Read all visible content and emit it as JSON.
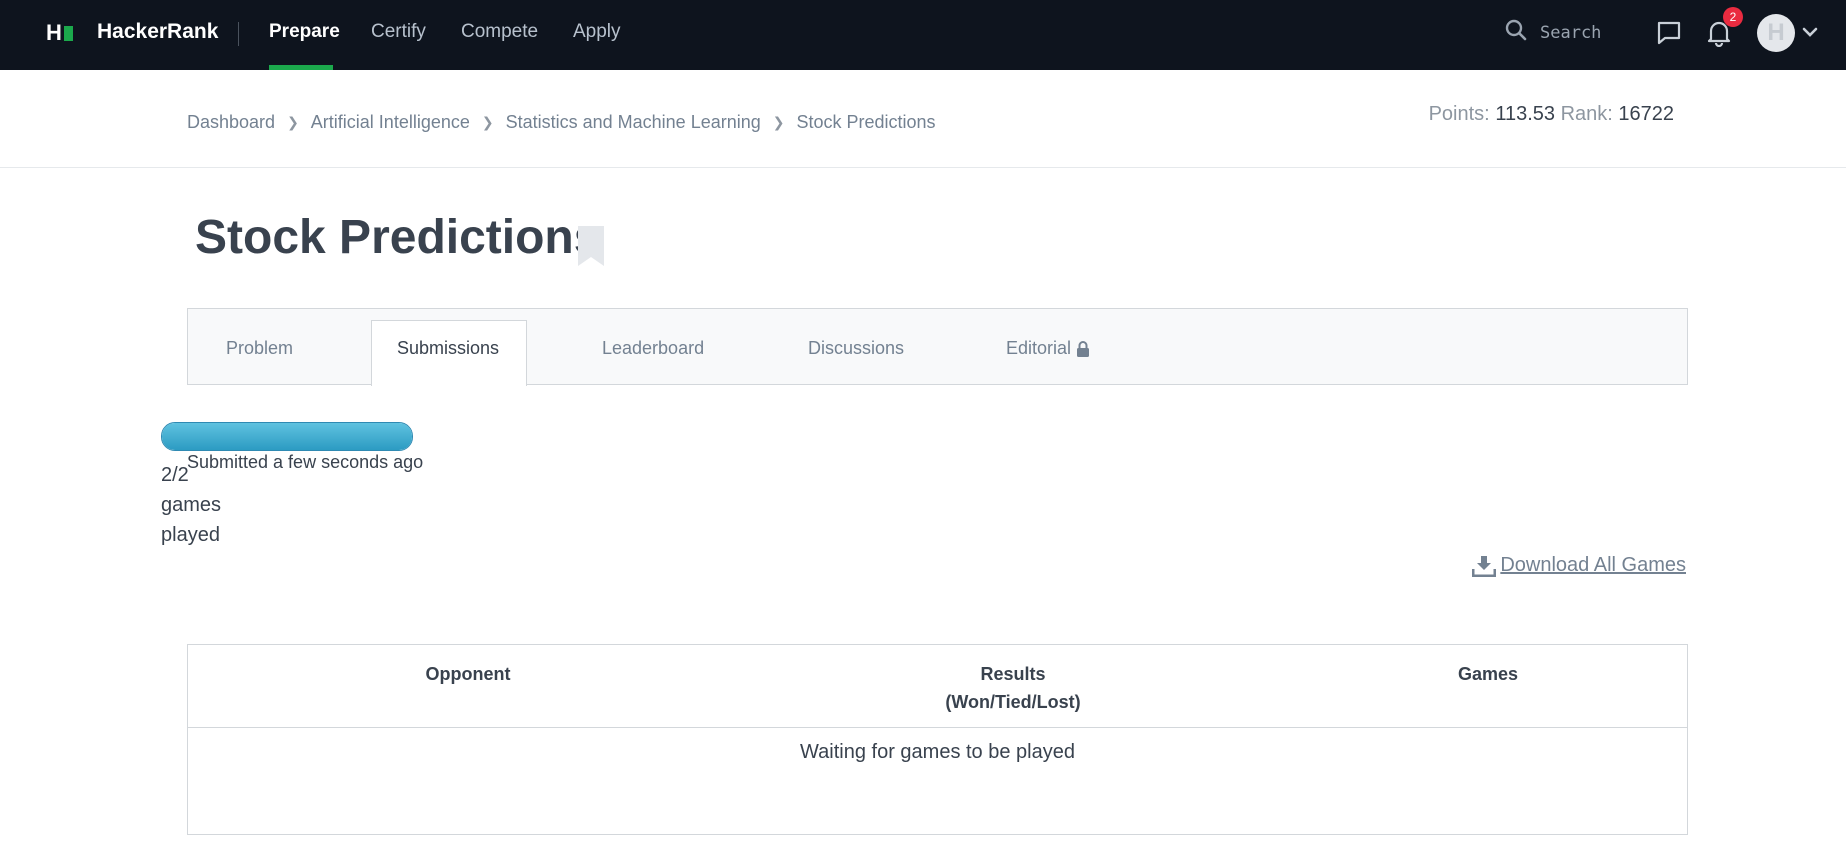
{
  "nav": {
    "logo_mark": "H",
    "brand": "HackerRank",
    "items": [
      {
        "label": "Prepare",
        "active": true
      },
      {
        "label": "Certify",
        "active": false
      },
      {
        "label": "Compete",
        "active": false
      },
      {
        "label": "Apply",
        "active": false
      }
    ],
    "search_placeholder": "Search",
    "notification_count": "2",
    "avatar_initial": "H",
    "icons": [
      "search-icon",
      "chat-icon",
      "bell-icon",
      "chevron-down-icon"
    ]
  },
  "breadcrumb": [
    "Dashboard",
    "Artificial Intelligence",
    "Statistics and Machine Learning",
    "Stock Predictions"
  ],
  "stats": {
    "points_label": "Points:",
    "points_value": "113.53",
    "rank_label": "Rank:",
    "rank_value": "16722"
  },
  "page": {
    "title": "Stock Predictions",
    "tabs": [
      "Problem",
      "Submissions",
      "Leaderboard",
      "Discussions",
      "Editorial"
    ],
    "active_tab": "Submissions"
  },
  "submission": {
    "progress_fraction": 1.0,
    "games_played": "2/2 games played",
    "submitted_text": "Submitted a few seconds ago",
    "download_label": "Download All Games"
  },
  "results": {
    "columns": [
      "Opponent",
      "Results",
      "(Won/Tied/Lost)",
      "Games"
    ],
    "empty_text": "Waiting for games to be played"
  },
  "colors": {
    "nav_bg": "#0e141e",
    "accent_green": "#1ba94c",
    "badge_red": "#ea2b40",
    "progress_blue": "#2c9bc2"
  }
}
